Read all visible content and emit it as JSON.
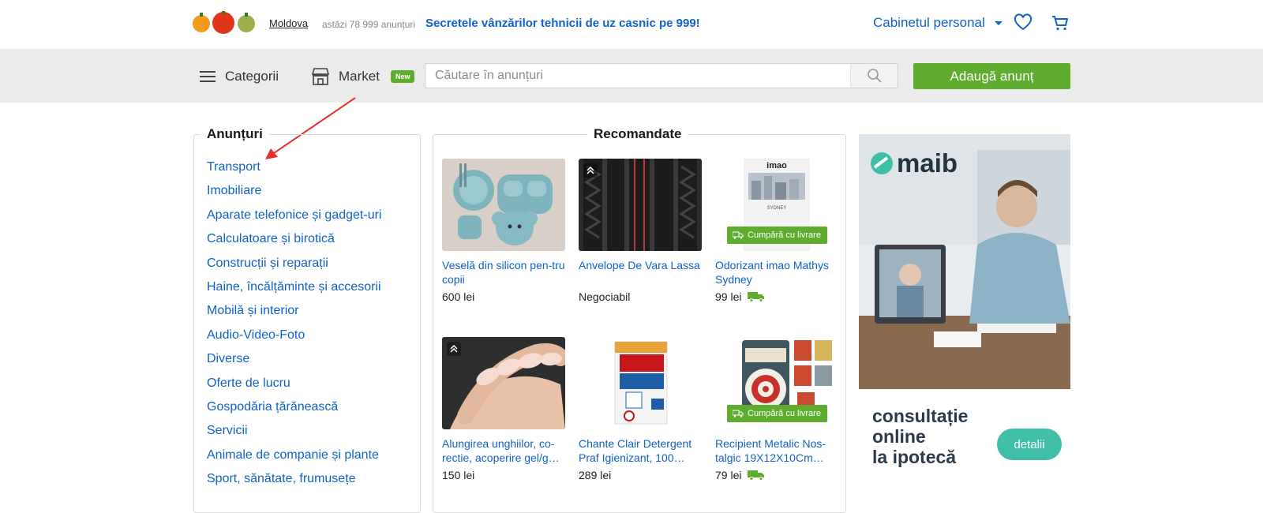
{
  "header": {
    "region": "Moldova",
    "today_text": "astăzi 78 999 anunțuri",
    "promo_text": "Secretele vânzărilor tehnicii de uz casnic pe 999!",
    "cabinet_label": "Cabinetul personal"
  },
  "nav": {
    "categories_label": "Categorii",
    "market_label": "Market",
    "new_badge": "New",
    "search_placeholder": "Căutare în anunțuri",
    "add_button": "Adaugă anunț"
  },
  "ads_panel": {
    "title": "Anunțuri",
    "categories": [
      "Transport",
      "Imobiliare",
      "Aparate telefonice și gadget-uri",
      "Calculatoare și birotică",
      "Construcții și reparații",
      "Haine, încălțăminte și accesorii",
      "Mobilă și interior",
      "Audio-Video-Foto",
      "Diverse",
      "Oferte de lucru",
      "Gospodăria țărănească",
      "Servicii",
      "Animale de companie și plante",
      "Sport, sănătate, frumusețe"
    ]
  },
  "recommended": {
    "title": "Recomandate",
    "delivery_badge": "Cumpără cu livrare",
    "items": [
      {
        "title": "Veselă din silicon pen-tru copii",
        "price": "600 lei"
      },
      {
        "title": "Anvelope De Vara Lassa",
        "price": "Negociabil"
      },
      {
        "title": "Odorizant imao Mathys Sydney",
        "price": "99 lei"
      },
      {
        "title": "Alungirea unghiilor, co-rectie, acoperire gel/g…",
        "price": "150 lei"
      },
      {
        "title": "Chante Clair Detergent Praf Igienizant, 100…",
        "price": "289 lei"
      },
      {
        "title": "Recipient Metalic Nos-talgic 19X12X10Cm…",
        "price": "79 lei"
      }
    ]
  },
  "banner": {
    "brand": "maib",
    "text_line1": "consultație",
    "text_line2": "online",
    "text_line3": "la ipotecă",
    "button": "detalii"
  },
  "colors": {
    "link_blue": "#0f62c8",
    "green": "#5fad2e",
    "teal": "#3fbfa8"
  }
}
